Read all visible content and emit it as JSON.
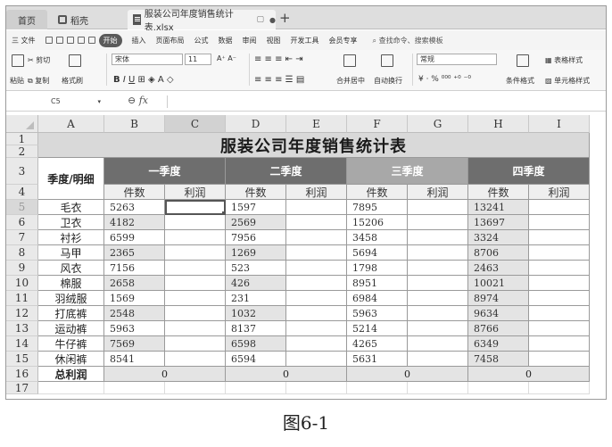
{
  "tabs": {
    "home": "首页",
    "wps": "稻壳",
    "file": "服装公司年度销售统计表.xlsx"
  },
  "menu": [
    "三 文件",
    "开始",
    "插入",
    "页面布局",
    "公式",
    "数据",
    "审阅",
    "视图",
    "开发工具",
    "会员专享"
  ],
  "menu_search": "查找命令、搜索模板",
  "ribbon": {
    "cut": "剪切",
    "copy": "复制",
    "paste": "粘贴",
    "format_painter": "格式刷",
    "font": "宋体",
    "size": "11",
    "merge": "合并居中",
    "wrap": "自动换行",
    "number_format": "常规",
    "table_style": "表格样式",
    "cond_format": "条件格式",
    "cell_style": "单元格样式"
  },
  "formula_bar": {
    "name_box": "C5",
    "fx": "fx"
  },
  "columns": [
    "A",
    "B",
    "C",
    "D",
    "E",
    "F",
    "G",
    "H",
    "I"
  ],
  "rows": [
    "1",
    "2",
    "3",
    "4",
    "5",
    "6",
    "7",
    "8",
    "9",
    "10",
    "11",
    "12",
    "13",
    "14",
    "15",
    "16",
    "17"
  ],
  "sheet": {
    "title": "服装公司年度销售统计表",
    "header_label": "季度/明细",
    "quarters": [
      "一季度",
      "二季度",
      "三季度",
      "四季度"
    ],
    "sub_headers": [
      "件数",
      "利润",
      "件数",
      "利润",
      "件数",
      "利润",
      "件数",
      "利润"
    ],
    "products": [
      {
        "name": "毛衣",
        "q1": "5263",
        "q2": "1597",
        "q3": "7895",
        "q4": "13241"
      },
      {
        "name": "卫衣",
        "q1": "4182",
        "q2": "2569",
        "q3": "15206",
        "q4": "13697"
      },
      {
        "name": "衬衫",
        "q1": "6599",
        "q2": "7956",
        "q3": "3458",
        "q4": "3324"
      },
      {
        "name": "马甲",
        "q1": "2365",
        "q2": "1269",
        "q3": "5694",
        "q4": "8706"
      },
      {
        "name": "风衣",
        "q1": "7156",
        "q2": "523",
        "q3": "1798",
        "q4": "2463"
      },
      {
        "name": "棉服",
        "q1": "2658",
        "q2": "426",
        "q3": "8951",
        "q4": "10021"
      },
      {
        "name": "羽绒服",
        "q1": "1569",
        "q2": "231",
        "q3": "6984",
        "q4": "8974"
      },
      {
        "name": "打底裤",
        "q1": "2548",
        "q2": "1032",
        "q3": "5963",
        "q4": "9634"
      },
      {
        "name": "运动裤",
        "q1": "5963",
        "q2": "8137",
        "q3": "5214",
        "q4": "8766"
      },
      {
        "name": "牛仔裤",
        "q1": "7569",
        "q2": "6598",
        "q3": "4265",
        "q4": "6349"
      },
      {
        "name": "休闲裤",
        "q1": "8541",
        "q2": "6594",
        "q3": "5631",
        "q4": "7458"
      }
    ],
    "total_label": "总利润",
    "totals": [
      "0",
      "0",
      "0",
      "0"
    ]
  },
  "caption": "图6-1"
}
